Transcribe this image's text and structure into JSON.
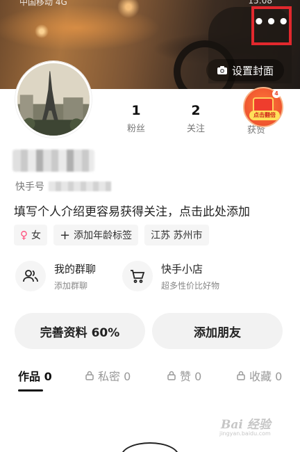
{
  "status_bar": {
    "left_text": "中国移动 4G",
    "right_text": "15:08"
  },
  "cover": {
    "set_cover_label": "设置封面",
    "more_label": "•••"
  },
  "stats": [
    {
      "value": "1",
      "label": "粉丝"
    },
    {
      "value": "2",
      "label": "关注"
    },
    {
      "value": "",
      "label": "获赞"
    }
  ],
  "redpacket": {
    "badge": "4",
    "tag_text": "点击翻倍"
  },
  "profile": {
    "id_label": "快手号",
    "bio": "填写个人介绍更容易获得关注，点击此处添加",
    "tags": [
      {
        "icon": "female-icon",
        "label": "女"
      },
      {
        "icon": "plus-icon",
        "label": "添加年龄标签"
      },
      {
        "icon": "",
        "label": "江苏 苏州市"
      }
    ]
  },
  "features": [
    {
      "icon": "group-chat-icon",
      "title": "我的群聊",
      "subtitle": "添加群聊"
    },
    {
      "icon": "cart-icon",
      "title": "快手小店",
      "subtitle": "超多性价比好物"
    }
  ],
  "actions": {
    "complete_profile": "完善资料 60%",
    "add_friends": "添加朋友"
  },
  "tabs": [
    {
      "label": "作品 0",
      "locked": false,
      "active": true
    },
    {
      "label": "私密 0",
      "locked": true,
      "active": false
    },
    {
      "label": "赞 0",
      "locked": true,
      "active": false
    },
    {
      "label": "收藏 0",
      "locked": true,
      "active": false
    }
  ],
  "watermark": {
    "main": "Bai 经验",
    "sub": "jingyan.baidu.com"
  },
  "colors": {
    "highlight_border": "#e2282d",
    "accent_pink": "#ff4c7a"
  }
}
